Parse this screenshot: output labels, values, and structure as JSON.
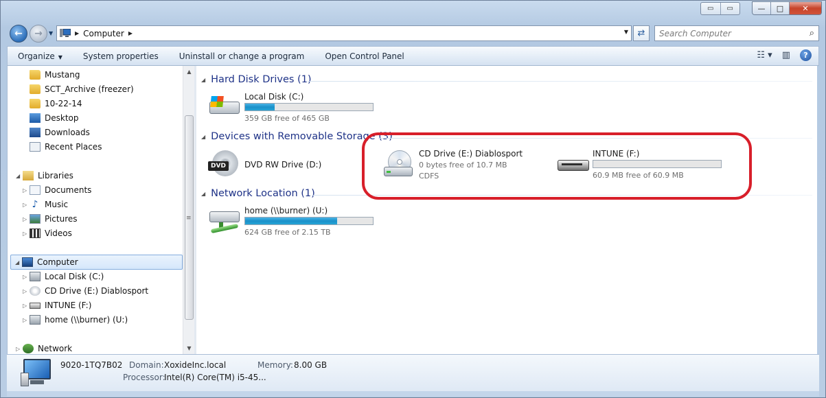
{
  "titlebar": {
    "minimize": "—",
    "maximize": "□",
    "close": "✕"
  },
  "address": {
    "crumbs": [
      "Computer"
    ]
  },
  "search": {
    "placeholder": "Search Computer"
  },
  "toolbar": {
    "organize": "Organize",
    "system_properties": "System properties",
    "uninstall": "Uninstall or change a program",
    "control_panel": "Open Control Panel"
  },
  "nav": {
    "favorites": [
      {
        "label": "Mustang",
        "icon": "folder-icon"
      },
      {
        "label": "SCT_Archive (freezer)",
        "icon": "folder-icon"
      },
      {
        "label": "10-22-14",
        "icon": "folder-icon"
      },
      {
        "label": "Desktop",
        "icon": "desktop-icon"
      },
      {
        "label": "Downloads",
        "icon": "downloads-icon"
      },
      {
        "label": "Recent Places",
        "icon": "recent-places-icon"
      }
    ],
    "libraries": {
      "label": "Libraries",
      "items": [
        "Documents",
        "Music",
        "Pictures",
        "Videos"
      ]
    },
    "computer": {
      "label": "Computer",
      "items": [
        "Local Disk (C:)",
        "CD Drive (E:) Diablosport",
        "INTUNE (F:)",
        "home (\\\\burner) (U:)"
      ]
    },
    "network": "Network"
  },
  "groups": {
    "hdd": "Hard Disk Drives (1)",
    "removable": "Devices with Removable Storage (3)",
    "network": "Network Location (1)"
  },
  "drives": {
    "c": {
      "name": "Local Disk (C:)",
      "free": "359 GB free of 465 GB",
      "used_fraction": 0.23
    },
    "d": {
      "name": "DVD RW Drive (D:)",
      "badge": "DVD"
    },
    "e": {
      "name": "CD Drive (E:) Diablosport",
      "free": "0 bytes free of 10.7 MB",
      "fs": "CDFS"
    },
    "f": {
      "name": "INTUNE (F:)",
      "free": "60.9 MB free of 60.9 MB",
      "used_fraction": 0.0
    },
    "u": {
      "name": "home (\\\\burner) (U:)",
      "free": "624 GB free of 2.15 TB",
      "used_fraction": 0.72
    }
  },
  "details": {
    "computer_name": "9020-1TQ7B02",
    "domain_label": "Domain:",
    "domain": "XoxideInc.local",
    "memory_label": "Memory:",
    "memory": "8.00 GB",
    "processor_label": "Processor:",
    "processor": "Intel(R) Core(TM) i5-45..."
  },
  "colors": {
    "accent_header": "#1e3287",
    "bar_fill": "#1a90c9",
    "highlight": "#d81f2a"
  }
}
